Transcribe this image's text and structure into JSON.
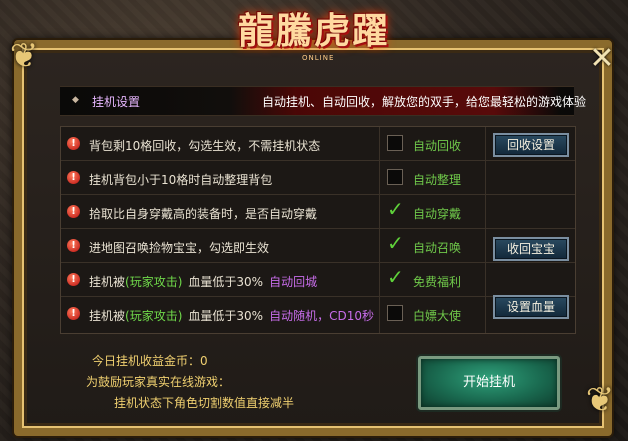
{
  "logo": {
    "text": "龍騰虎躍",
    "sub": "ONLINE"
  },
  "header": {
    "title": "挂机设置",
    "slogan": "自动挂机、自动回收，解放您的双手，给您最轻松的游戏体验"
  },
  "rows": [
    {
      "parts": [
        {
          "text": "背包剩10格回收，勾选生效，不需挂机状态",
          "color": "normal"
        }
      ],
      "checked": false,
      "option": "自动回收"
    },
    {
      "parts": [
        {
          "text": "挂机背包小于10格时自动整理背包",
          "color": "normal"
        }
      ],
      "checked": false,
      "option": "自动整理"
    },
    {
      "parts": [
        {
          "text": "拾取比自身穿戴高的装备时，是否自动穿戴",
          "color": "normal"
        }
      ],
      "checked": true,
      "option": "自动穿戴"
    },
    {
      "parts": [
        {
          "text": "进地图召唤捡物宝宝，勾选即生效",
          "color": "normal"
        }
      ],
      "checked": true,
      "option": "自动召唤"
    },
    {
      "parts": [
        {
          "text": "挂机被",
          "color": "normal"
        },
        {
          "text": "(玩家攻击)",
          "color": "green"
        },
        {
          "text": "血量低于30%",
          "color": "normal"
        },
        {
          "text": "自动回城",
          "color": "purple"
        }
      ],
      "checked": true,
      "option": "免费福利"
    },
    {
      "parts": [
        {
          "text": "挂机被",
          "color": "normal"
        },
        {
          "text": "(玩家攻击)",
          "color": "green"
        },
        {
          "text": "血量低于30%",
          "color": "normal"
        },
        {
          "text": "自动随机，CD10秒",
          "color": "purple"
        }
      ],
      "checked": false,
      "option": "白嫖大使"
    }
  ],
  "buttons": {
    "recycle": "回收设置",
    "recall_pet": "收回宝宝",
    "set_hp": "设置血量",
    "start": "开始挂机"
  },
  "footer": {
    "income_label": "今日挂机收益金币：",
    "income_value": "0",
    "encourage": "为鼓励玩家真实在线游戏：",
    "halved": "挂机状态下角色切割数值直接减半"
  },
  "icons": {
    "close": "close-icon",
    "exclamation": "exclamation-icon",
    "diamond": "diamond-icon",
    "check": "check-icon"
  },
  "colors": {
    "frame_gold": "#8a6a2c",
    "green_text": "#6fc84a",
    "purple_text": "#c66ce8",
    "gold_text": "#f0d070",
    "start_green": "#1a6a50"
  }
}
